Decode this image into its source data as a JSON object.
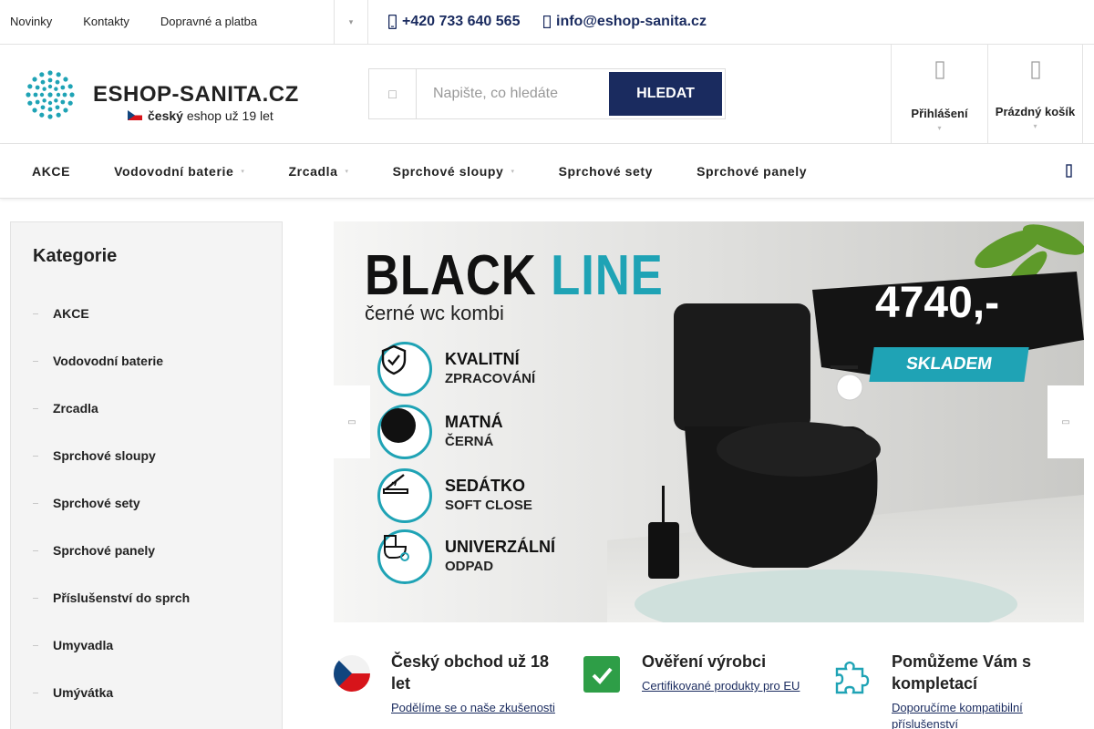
{
  "topbar": {
    "links": [
      "Novinky",
      "Kontakty",
      "Dopravné a platba"
    ],
    "phone": "+420 733 640 565",
    "email": "info@eshop-sanita.cz"
  },
  "logo": {
    "name": "ESHOP-SANITA.CZ",
    "tagline_bold": "český",
    "tagline_rest": " eshop už 19 let"
  },
  "search": {
    "placeholder": "Napište, co hledáte",
    "button": "HLEDAT"
  },
  "header": {
    "login": "Přihlášení",
    "cart": "Prázdný košík"
  },
  "nav": {
    "items": [
      {
        "label": "AKCE",
        "dropdown": false
      },
      {
        "label": "Vodovodní baterie",
        "dropdown": true
      },
      {
        "label": "Zrcadla",
        "dropdown": true
      },
      {
        "label": "Sprchové sloupy",
        "dropdown": true
      },
      {
        "label": "Sprchové sety",
        "dropdown": false
      },
      {
        "label": "Sprchové panely",
        "dropdown": false
      }
    ]
  },
  "sidebar": {
    "title": "Kategorie",
    "items": [
      "AKCE",
      "Vodovodní baterie",
      "Zrcadla",
      "Sprchové sloupy",
      "Sprchové sety",
      "Sprchové panely",
      "Příslušenství do sprch",
      "Umyvadla",
      "Umývátka"
    ]
  },
  "banner": {
    "title_main": "BLACK",
    "title_accent": "LINE",
    "subtitle": "černé wc kombi",
    "features": [
      {
        "line1": "KVALITNÍ",
        "line2": "ZPRACOVÁNÍ"
      },
      {
        "line1": "MATNÁ",
        "line2": "ČERNÁ"
      },
      {
        "line1": "SEDÁTKO",
        "line2": "SOFT CLOSE"
      },
      {
        "line1": "UNIVERZÁLNÍ",
        "line2": "ODPAD"
      }
    ],
    "price": "4740,-",
    "stock": "SKLADEM",
    "accent_color": "#1fa3b5"
  },
  "benefits": [
    {
      "title": "Český obchod už 18 let",
      "link": "Podělíme se o naše zkušenosti"
    },
    {
      "title": "Ověření výrobci",
      "link": "Certifikované produkty pro EU"
    },
    {
      "title": "Pomůžeme Vám s kompletací",
      "link": "Doporučíme kompatibilní příslušenství"
    }
  ],
  "colors": {
    "brand": "#1a2b5f",
    "teal": "#1fa3b5",
    "green": "#2e9e47"
  }
}
